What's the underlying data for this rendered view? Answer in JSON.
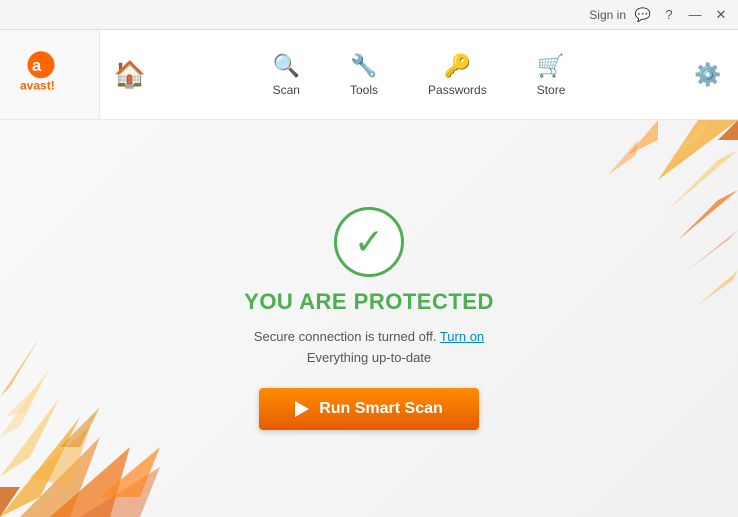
{
  "titleBar": {
    "signIn": "Sign in",
    "help": "?",
    "minimize": "—",
    "close": "✕"
  },
  "logo": {
    "text": "avast!"
  },
  "nav": {
    "items": [
      {
        "id": "scan",
        "label": "Scan",
        "icon": "🔍"
      },
      {
        "id": "tools",
        "label": "Tools",
        "icon": "🔧"
      },
      {
        "id": "passwords",
        "label": "Passwords",
        "icon": "🔑"
      },
      {
        "id": "store",
        "label": "Store",
        "icon": "🛒"
      }
    ]
  },
  "main": {
    "statusTitle": "YOU ARE ",
    "statusHighlight": "PROTECTED",
    "line1": "Secure connection is turned off.",
    "turnOnText": "Turn on",
    "line2": "Everything up-to-date",
    "scanButton": "Run Smart Scan"
  }
}
